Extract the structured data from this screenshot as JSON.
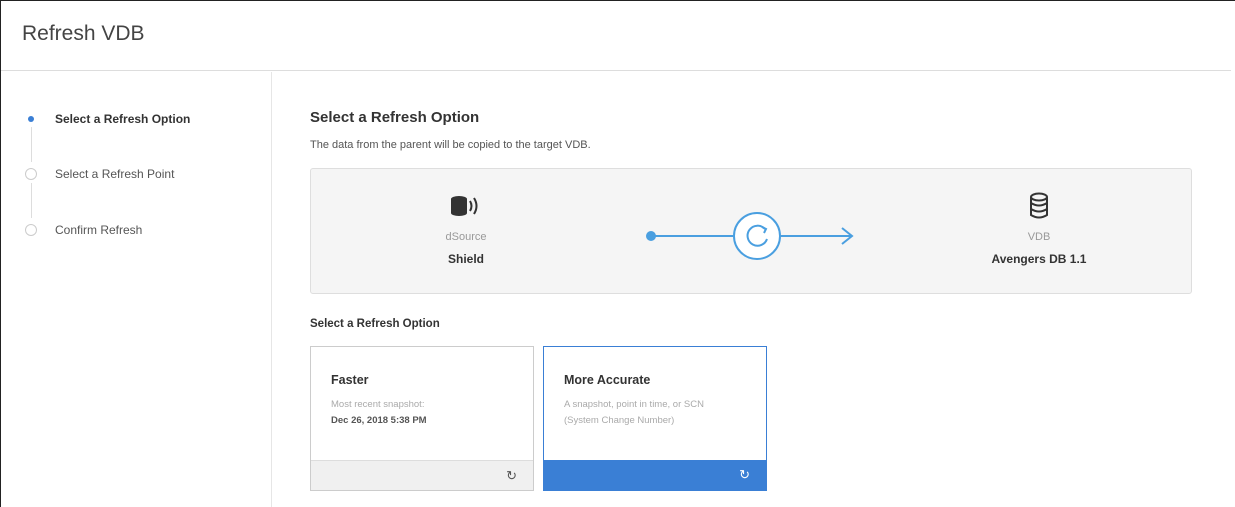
{
  "header": {
    "title": "Refresh VDB"
  },
  "steps": [
    {
      "label": "Select a Refresh Option",
      "active": true
    },
    {
      "label": "Select a Refresh Point",
      "active": false
    },
    {
      "label": "Confirm Refresh",
      "active": false
    }
  ],
  "main": {
    "title": "Select a Refresh Option",
    "description": "The data from the parent will be copied to the target VDB.",
    "flow": {
      "source": {
        "type": "dSource",
        "name": "Shield",
        "icon": "dsource-icon"
      },
      "target": {
        "type": "VDB",
        "name": "Avengers DB 1.1",
        "icon": "database-icon"
      },
      "connector_icon": "refresh-icon"
    },
    "options_heading": "Select a Refresh Option",
    "options": [
      {
        "title": "Faster",
        "line1": "Most recent snapshot:",
        "line2": "Dec 26, 2018 5:38 PM",
        "selected": false
      },
      {
        "title": "More Accurate",
        "line1": "A snapshot, point in time, or SCN",
        "line2": "(System Change Number)",
        "selected": true
      }
    ],
    "refresh_glyph": "↻"
  },
  "colors": {
    "accent": "#3a7fd5",
    "panel": "#f5f5f5",
    "border": "#dedede"
  }
}
